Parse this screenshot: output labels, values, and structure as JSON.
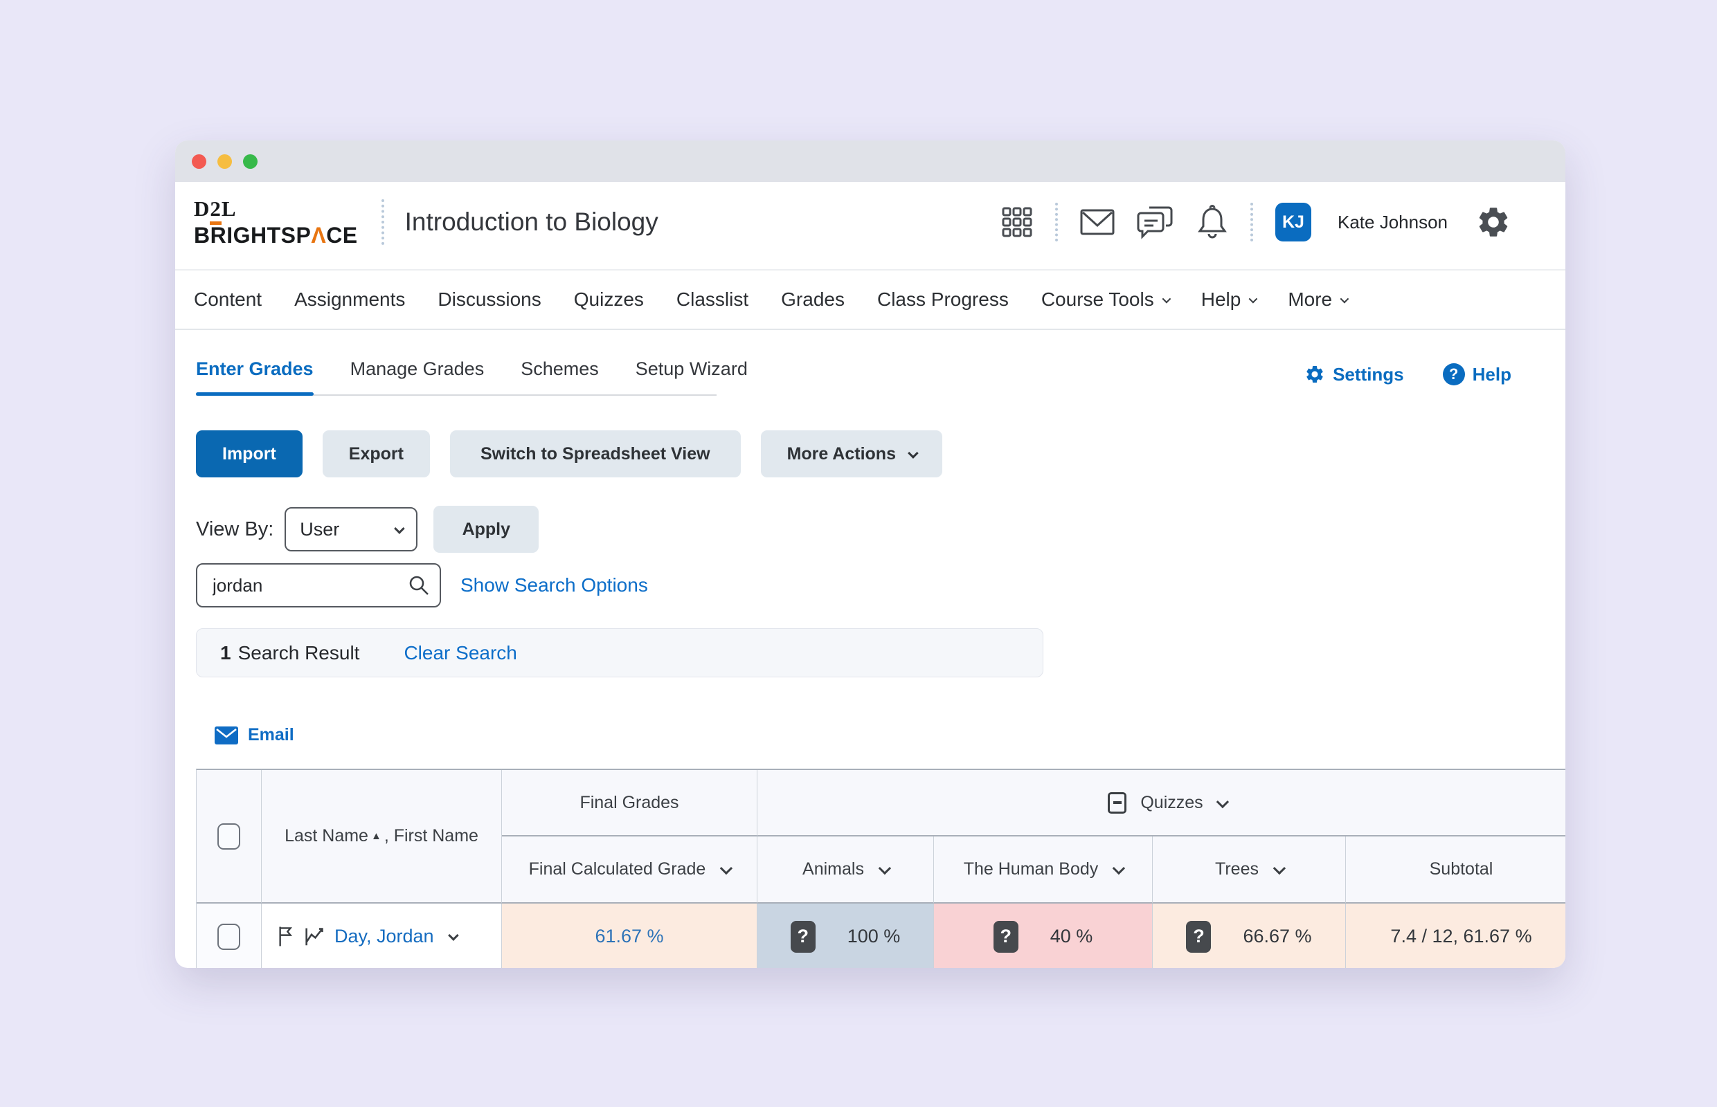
{
  "colors": {
    "accent_blue": "#0a6cc0",
    "link_blue": "#0d6ec9",
    "logo_orange": "#e87511",
    "peach_cell": "#fcebe0",
    "blue_cell": "#c9d5e2",
    "pink_cell": "#f9d2d4",
    "page_background": "#e9e7f8"
  },
  "header": {
    "logo": {
      "d2l_pre": "D",
      "d2l_two": "2",
      "d2l_post": "L",
      "bs_pre": "BRIGHTSP",
      "bs_caret": "Λ",
      "bs_post": "CE"
    },
    "course_title": "Introduction to Biology",
    "user": {
      "initials": "KJ",
      "name": "Kate Johnson"
    }
  },
  "nav": {
    "items": [
      {
        "label": "Content"
      },
      {
        "label": "Assignments"
      },
      {
        "label": "Discussions"
      },
      {
        "label": "Quizzes"
      },
      {
        "label": "Classlist"
      },
      {
        "label": "Grades"
      },
      {
        "label": "Class Progress"
      },
      {
        "label": "Course Tools"
      },
      {
        "label": "Help"
      },
      {
        "label": "More"
      }
    ]
  },
  "tabs": {
    "items": [
      "Enter Grades",
      "Manage Grades",
      "Schemes",
      "Setup Wizard"
    ],
    "active": "Enter Grades",
    "settings_label": "Settings",
    "help_label": "Help",
    "help_icon_char": "?"
  },
  "toolbar": {
    "import_label": "Import",
    "export_label": "Export",
    "spreadsheet_label": "Switch to Spreadsheet View",
    "more_actions_label": "More Actions"
  },
  "view_by": {
    "label": "View By:",
    "value": "User",
    "apply_label": "Apply"
  },
  "search": {
    "value": "jordan",
    "show_options_label": "Show Search Options",
    "result_count": "1",
    "result_text": "Search Result",
    "clear_label": "Clear Search"
  },
  "email_label": "Email",
  "table": {
    "headers": {
      "name_col_pre": "Last Name",
      "sort_asc_icon": "▲",
      "name_col_post": ", First Name",
      "final_grades": "Final Grades",
      "quizzes_group": "Quizzes",
      "final_calculated": "Final Calculated Grade",
      "animals": "Animals",
      "human_body": "The Human Body",
      "trees": "Trees",
      "subtotal": "Subtotal"
    },
    "row": {
      "name": "Day, Jordan",
      "final_calculated": "61.67 %",
      "animals": "100 %",
      "human_body": "40 %",
      "trees": "66.67 %",
      "subtotal": "7.4 / 12, 61.67 %",
      "question_badge_char": "?"
    }
  }
}
